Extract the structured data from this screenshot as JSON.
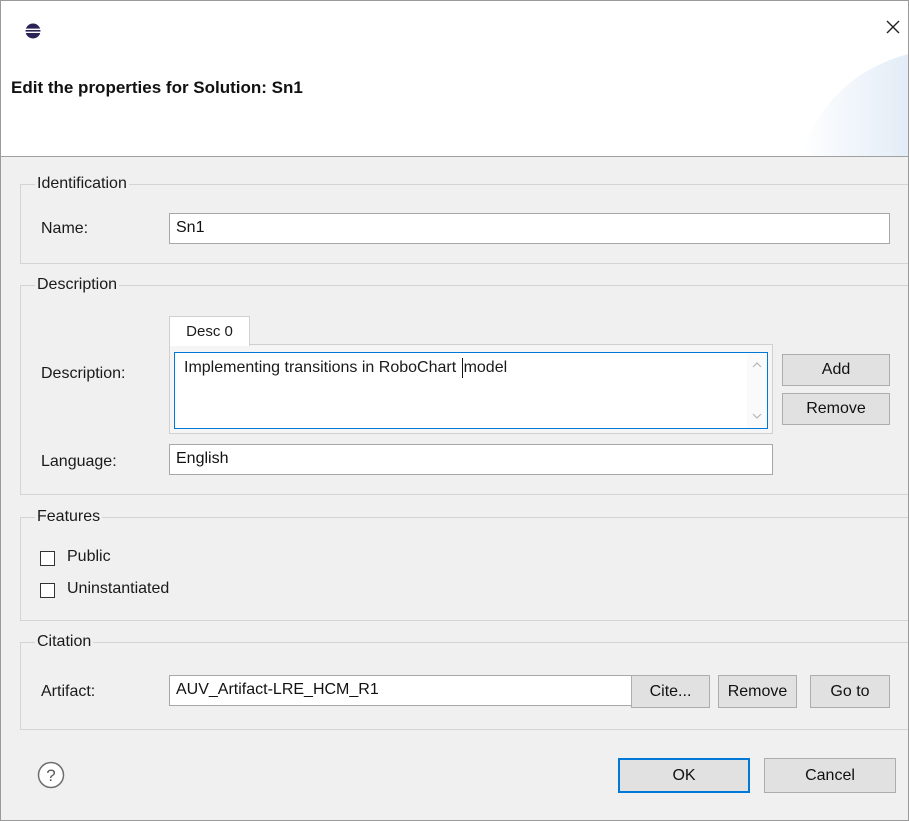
{
  "window": {
    "title": "Edit the properties for Solution: Sn1",
    "app_icon": "eclipse-icon",
    "close_icon": "close-icon"
  },
  "identification": {
    "group_title": "Identification",
    "name_label": "Name:",
    "name_value": "Sn1"
  },
  "description": {
    "group_title": "Description",
    "tab_label": "Desc 0",
    "description_label": "Description:",
    "description_value_before_caret": "Implementing transitions in RoboChart ",
    "description_value_after_caret": "model",
    "add_label": "Add",
    "remove_label": "Remove",
    "language_label": "Language:",
    "language_value": "English"
  },
  "features": {
    "group_title": "Features",
    "public_label": "Public",
    "public_checked": false,
    "uninstantiated_label": "Uninstantiated",
    "uninstantiated_checked": false
  },
  "citation": {
    "group_title": "Citation",
    "artifact_label": "Artifact:",
    "artifact_value": "AUV_Artifact-LRE_HCM_R1",
    "cite_label": "Cite...",
    "remove_label": "Remove",
    "goto_label": "Go to"
  },
  "footer": {
    "help_icon": "help-icon",
    "ok_label": "OK",
    "cancel_label": "Cancel"
  },
  "colors": {
    "accent": "#0078d7",
    "dialog_bg": "#f0f0f0",
    "button_bg": "#e1e1e1"
  }
}
